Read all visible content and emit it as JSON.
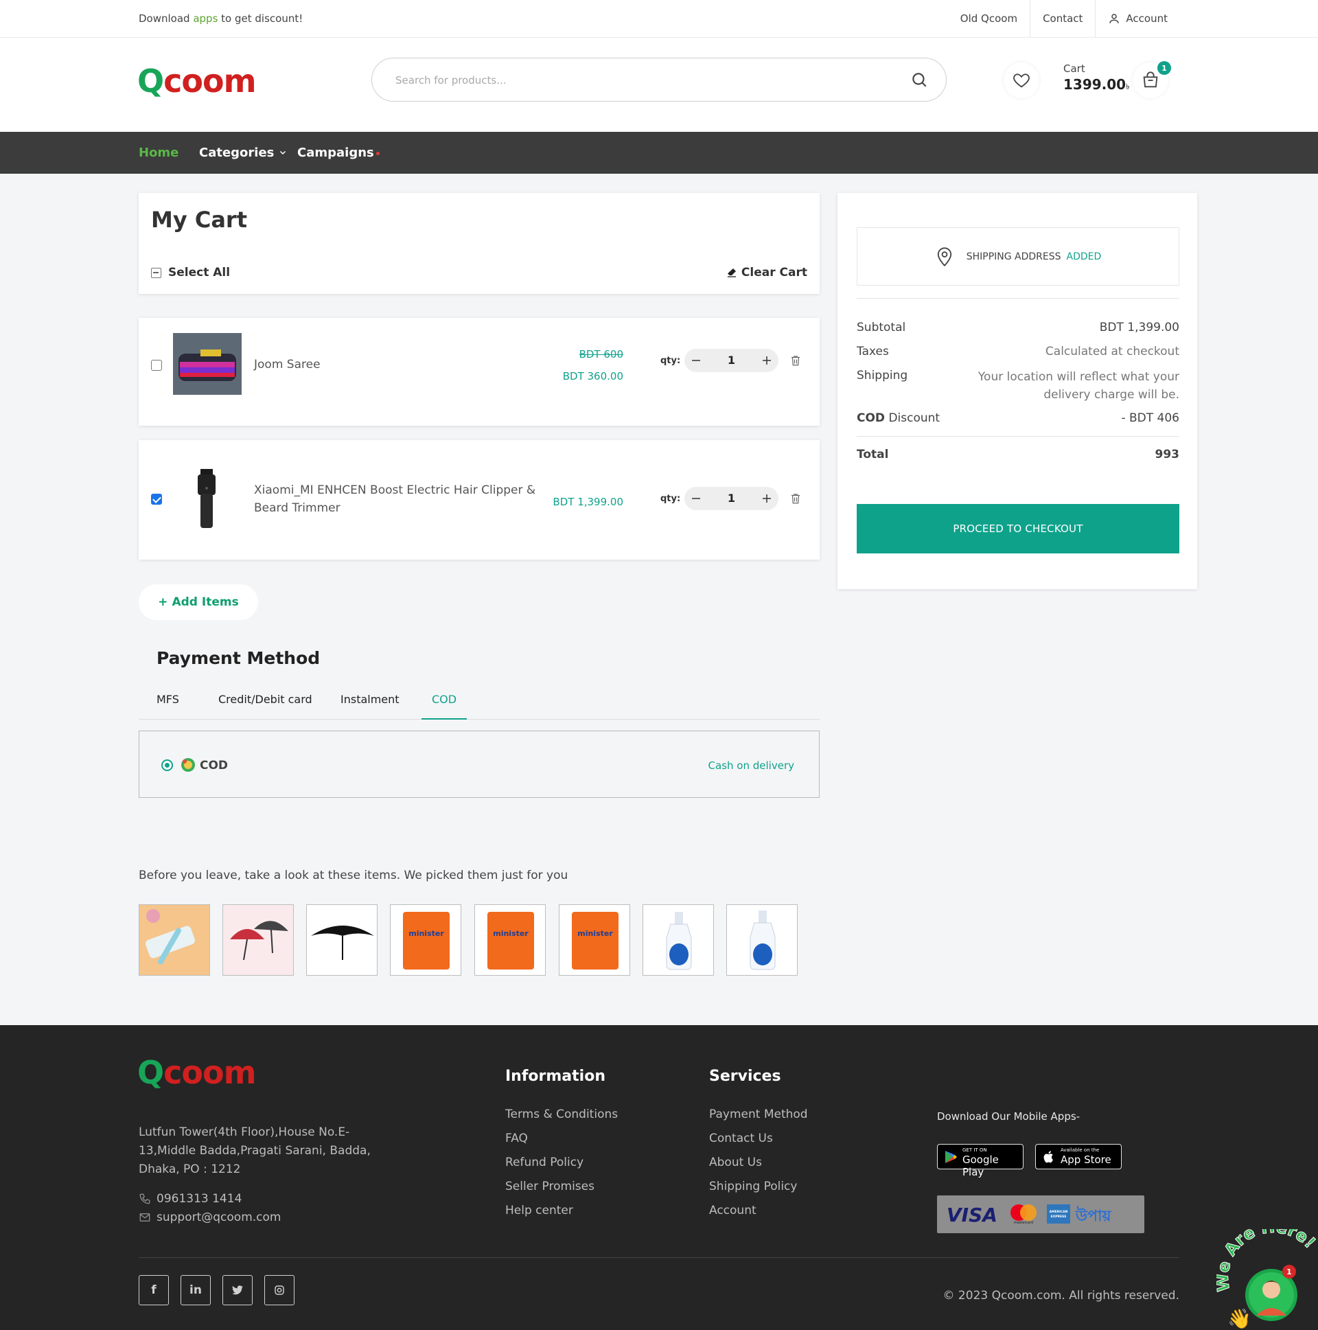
{
  "topbar": {
    "promo_prefix": "Download ",
    "promo_link": "apps",
    "promo_suffix": " to get discount!",
    "links": [
      "Old Qcoom",
      "Contact",
      "Account"
    ]
  },
  "header": {
    "logo_q": "Q",
    "logo_rest": "coom",
    "search_placeholder": "Search for products...",
    "cart_label": "Cart",
    "cart_amount": "1399.00",
    "cart_currency": "৳",
    "cart_count": "1"
  },
  "nav": {
    "items": [
      "Home",
      "Categories",
      "Campaigns"
    ]
  },
  "cart": {
    "title": "My Cart",
    "select_all": "Select All",
    "clear_cart": "Clear Cart",
    "qty_label": "qty:",
    "items": [
      {
        "name": "Joom Saree",
        "old_price": "BDT 600",
        "price": "BDT 360.00",
        "qty": "1",
        "checked": false
      },
      {
        "name_line1": "Xiaomi_MI ENHCEN Boost Electric Hair Clipper &",
        "name_line2": "Beard Trimmer",
        "price": "BDT 1,399.00",
        "qty": "1",
        "checked": true
      }
    ],
    "add_items": "+ Add Items"
  },
  "payment": {
    "title": "Payment Method",
    "tabs": [
      "MFS",
      "Credit/Debit card",
      "Instalment",
      "COD"
    ],
    "active_tab": "COD",
    "option_label": "COD",
    "option_desc": "Cash on delivery"
  },
  "summary": {
    "shipping_address_label": "SHIPPING ADDRESS",
    "shipping_address_status": "ADDED",
    "subtotal_label": "Subtotal",
    "subtotal_value": "BDT 1,399.00",
    "taxes_label": "Taxes",
    "taxes_value": "Calculated at checkout",
    "shipping_label": "Shipping",
    "shipping_value_line1": "Your location will reflect what your",
    "shipping_value_line2": "delivery charge will be.",
    "cod_discount_label_bold": "COD",
    "cod_discount_label_rest": " Discount",
    "cod_discount_value": "- BDT 406",
    "total_label": "Total",
    "total_value": "993",
    "checkout_button": "PROCEED TO CHECKOUT"
  },
  "recommendations": {
    "title": "Before you leave, take a look at these items. We picked them just for you"
  },
  "footer": {
    "address": "Lutfun Tower(4th Floor),House No.E-13,Middle Badda,Pragati Sarani, Badda, Dhaka, PO : 1212",
    "phone": "0961313 1414",
    "email": "support@qcoom.com",
    "information_title": "Information",
    "information_links": [
      "Terms & Conditions",
      "FAQ",
      "Refund Policy",
      "Seller Promises",
      "Help center"
    ],
    "services_title": "Services",
    "services_links": [
      "Payment Method",
      "Contact Us",
      "About Us",
      "Shipping Policy",
      "Account"
    ],
    "download_label": "Download Our Mobile Apps-",
    "google_small": "GET IT ON",
    "google_big": "Google Play",
    "apple_small": "Available on the",
    "apple_big": "App Store",
    "payment_logos": [
      "VISA",
      "mastercard",
      "AMERICAN EXPRESS",
      "উপায়"
    ],
    "copyright": "© 2023 Qcoom.com. All rights reserved."
  },
  "chat": {
    "text": "We Are Here!",
    "badge": "1"
  },
  "colors": {
    "accent": "#0fa28b",
    "nav_bg": "#3c3c3c",
    "footer_bg": "#252525",
    "logo_green": "#18a558",
    "logo_red": "#d0201f"
  }
}
